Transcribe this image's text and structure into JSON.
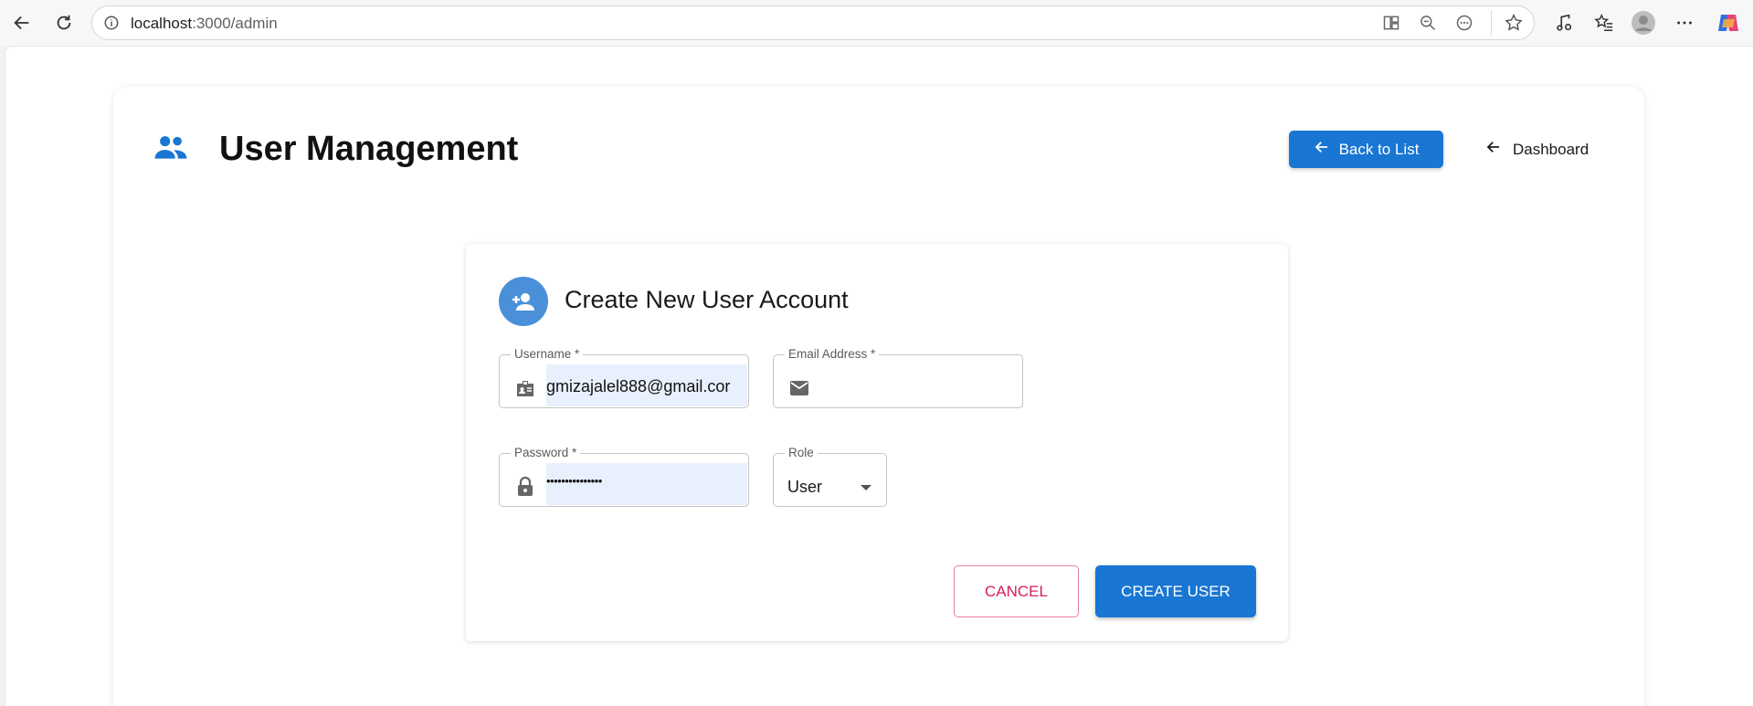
{
  "browser": {
    "url_host": "localhost",
    "url_path": ":3000/admin"
  },
  "page": {
    "title": "User Management",
    "back_button_label": "Back to List",
    "dashboard_link_label": "Dashboard"
  },
  "form": {
    "title": "Create New User Account",
    "fields": {
      "username": {
        "label": "Username *",
        "value": "gmizajalel888@gmail.cor"
      },
      "email": {
        "label": "Email Address *",
        "value": ""
      },
      "password": {
        "label": "Password *",
        "value": "•••••••••••••••"
      },
      "role": {
        "label": "Role",
        "value": "User"
      }
    },
    "cancel_label": "CANCEL",
    "create_label": "CREATE USER"
  },
  "colors": {
    "primary": "#1976d2",
    "cancel": "#d81b60",
    "autofill": "#e8f0fe",
    "avatar": "#4a90d9"
  },
  "icons": {
    "browser": [
      "back-icon",
      "reload-icon",
      "info-icon",
      "split-view-icon",
      "zoom-out-icon",
      "more-page-icon",
      "favorite-star-icon",
      "media-icon",
      "favorites-list-icon",
      "profile-icon",
      "settings-more-icon",
      "copilot-icon"
    ],
    "page": [
      "people-icon",
      "arrow-left-icon",
      "person-add-icon",
      "badge-icon",
      "email-icon",
      "lock-icon",
      "dropdown-caret-icon"
    ]
  }
}
